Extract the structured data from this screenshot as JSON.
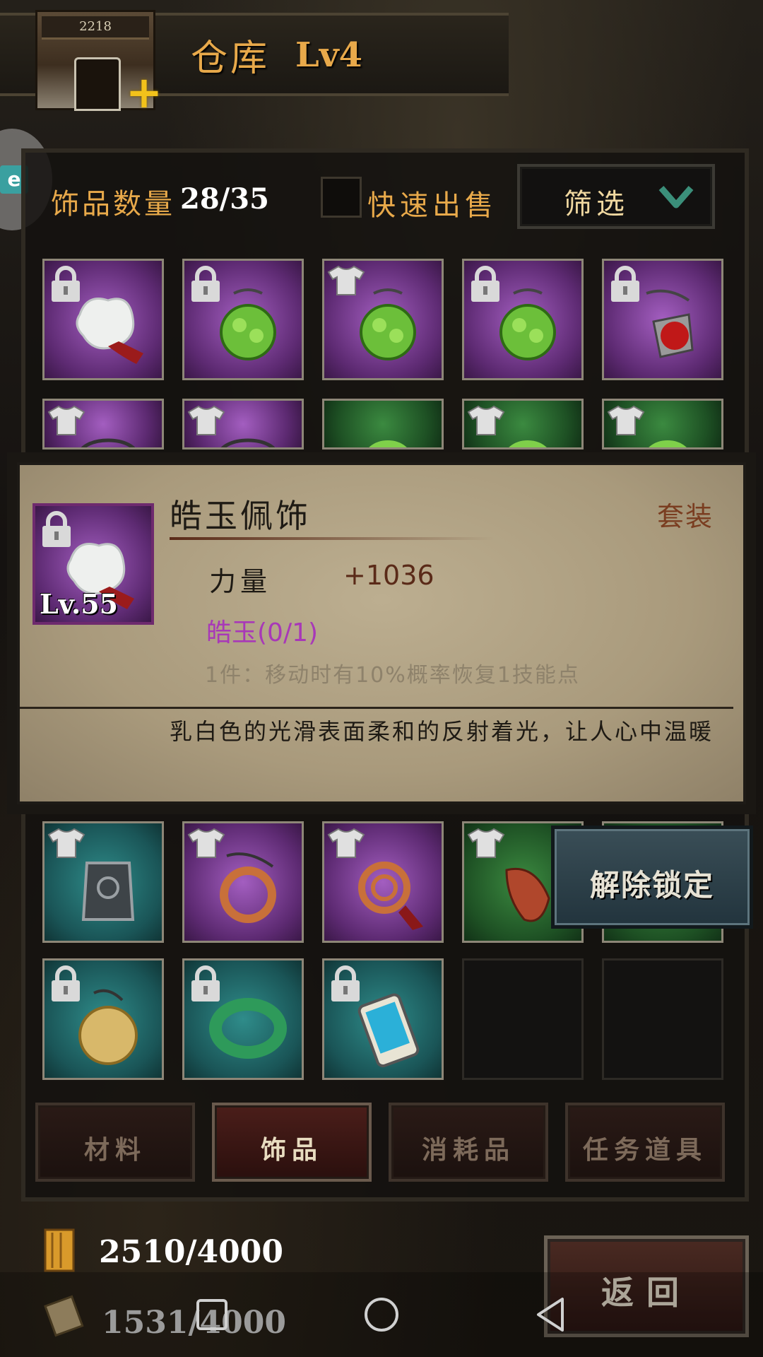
{
  "header": {
    "title": "仓库",
    "level": "Lv4",
    "building_sign": "2218"
  },
  "side_badge": "e",
  "inventory": {
    "count_label": "饰品数量",
    "count_value": "28/35",
    "quick_sell_label": "快速出售",
    "quick_sell_checked": false,
    "filter_label": "筛选",
    "rows": [
      [
        {
          "rarity": "purple",
          "badge": "lock",
          "item": "white-jade-pendant-icon"
        },
        {
          "rarity": "purple",
          "badge": "lock",
          "item": "green-jade-charm-icon"
        },
        {
          "rarity": "purple",
          "badge": "shirt",
          "item": "green-jade-charm-icon"
        },
        {
          "rarity": "purple",
          "badge": "lock",
          "item": "green-jade-charm-icon"
        },
        {
          "rarity": "purple",
          "badge": "lock",
          "item": "red-bead-pendant-icon"
        }
      ],
      [
        {
          "rarity": "purple",
          "badge": "shirt",
          "item": "string-pendant-icon"
        },
        {
          "rarity": "purple",
          "badge": "shirt",
          "item": "blue-bead-pendant-icon"
        },
        {
          "rarity": "green",
          "badge": "none",
          "item": "green-ring-icon"
        },
        {
          "rarity": "green",
          "badge": "shirt",
          "item": "green-ring-icon"
        },
        {
          "rarity": "green",
          "badge": "shirt",
          "item": "green-ring-icon"
        }
      ],
      [
        {
          "rarity": "teal",
          "badge": "shirt",
          "item": "silver-lock-amulet-icon"
        },
        {
          "rarity": "purple",
          "badge": "shirt",
          "item": "copper-ring-icon"
        },
        {
          "rarity": "purple",
          "badge": "shirt",
          "item": "copper-coil-tassel-icon"
        },
        {
          "rarity": "green",
          "badge": "shirt",
          "item": "red-fish-charm-icon"
        },
        {
          "rarity": "green",
          "badge": "none",
          "item": "hidden-item-icon"
        }
      ],
      [
        {
          "rarity": "teal",
          "badge": "lock",
          "item": "tap-gold-coin-icon"
        },
        {
          "rarity": "teal",
          "badge": "lock",
          "item": "tap-jade-bracelet-icon"
        },
        {
          "rarity": "teal",
          "badge": "lock",
          "item": "tap-phone-icon"
        },
        {
          "rarity": "empty",
          "badge": "none",
          "item": ""
        },
        {
          "rarity": "empty",
          "badge": "none",
          "item": ""
        }
      ]
    ]
  },
  "tooltip": {
    "item_name": "皓玉佩饰",
    "set_tag": "套装",
    "level": "Lv.55",
    "stat_name": "力量",
    "stat_value": "+1036",
    "set_name": "皓玉(0/1)",
    "set_effect": "1件：移动时有10%概率恢复1技能点",
    "description": "乳白色的光滑表面柔和的反射着光，让人心中温暖",
    "colors": {
      "set_name": "#a838b8",
      "stat_value": "#5a2a18"
    }
  },
  "unlock_button": "解除锁定",
  "tabs": [
    {
      "label": "材料",
      "active": false
    },
    {
      "label": "饰品",
      "active": true
    },
    {
      "label": "消耗品",
      "active": false
    },
    {
      "label": "任务道具",
      "active": false
    }
  ],
  "resources": [
    {
      "icon": "book-icon",
      "value": "2510/4000"
    },
    {
      "icon": "scroll-icon",
      "value": "1531/4000"
    }
  ],
  "back_button": "返回",
  "navbar": [
    {
      "icon": "recent-apps-icon"
    },
    {
      "icon": "home-circle-icon"
    },
    {
      "icon": "back-triangle-icon"
    }
  ],
  "accent_color": "#e8a94a"
}
